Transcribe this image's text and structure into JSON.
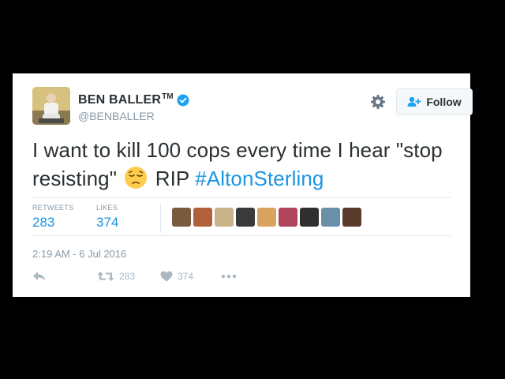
{
  "author": {
    "name": "BEN BALLER",
    "trademark": "TM",
    "handle": "@BENBALLER",
    "avatar": "avatar-photo",
    "verified": true
  },
  "header": {
    "gear_icon": "gear-icon",
    "follow_label": "Follow",
    "follow_icon": "add-user-icon"
  },
  "tweet": {
    "text_part1": "I want to kill 100 cops every time I hear \"stop resisting\"",
    "emoji": "pensive-face-emoji",
    "text_part2": "RIP",
    "hashtag": "#AltonSterling"
  },
  "stats": {
    "retweets_label": "RETWEETS",
    "retweets_value": "283",
    "likes_label": "LIKES",
    "likes_value": "374"
  },
  "likers": [
    {
      "name": "liker-avatar-1",
      "color": "#7a5a3c"
    },
    {
      "name": "liker-avatar-2",
      "color": "#b0603a"
    },
    {
      "name": "liker-avatar-3",
      "color": "#c8b28a"
    },
    {
      "name": "liker-avatar-4",
      "color": "#3a3a3a"
    },
    {
      "name": "liker-avatar-5",
      "color": "#d9a35f"
    },
    {
      "name": "liker-avatar-6",
      "color": "#b0445a"
    },
    {
      "name": "liker-avatar-7",
      "color": "#2f2f2f"
    },
    {
      "name": "liker-avatar-8",
      "color": "#6a8fa8"
    },
    {
      "name": "liker-avatar-9",
      "color": "#5a3a2a"
    }
  ],
  "timestamp": "2:19 AM - 6 Jul 2016",
  "actions": {
    "reply_icon": "reply-icon",
    "retweet_icon": "retweet-icon",
    "retweet_count": "283",
    "like_icon": "heart-icon",
    "like_count": "374",
    "more_icon": "more-icon"
  },
  "colors": {
    "link": "#1b95e0",
    "text": "#292f33",
    "muted": "#8899a6",
    "verified": "#1da1f2"
  }
}
